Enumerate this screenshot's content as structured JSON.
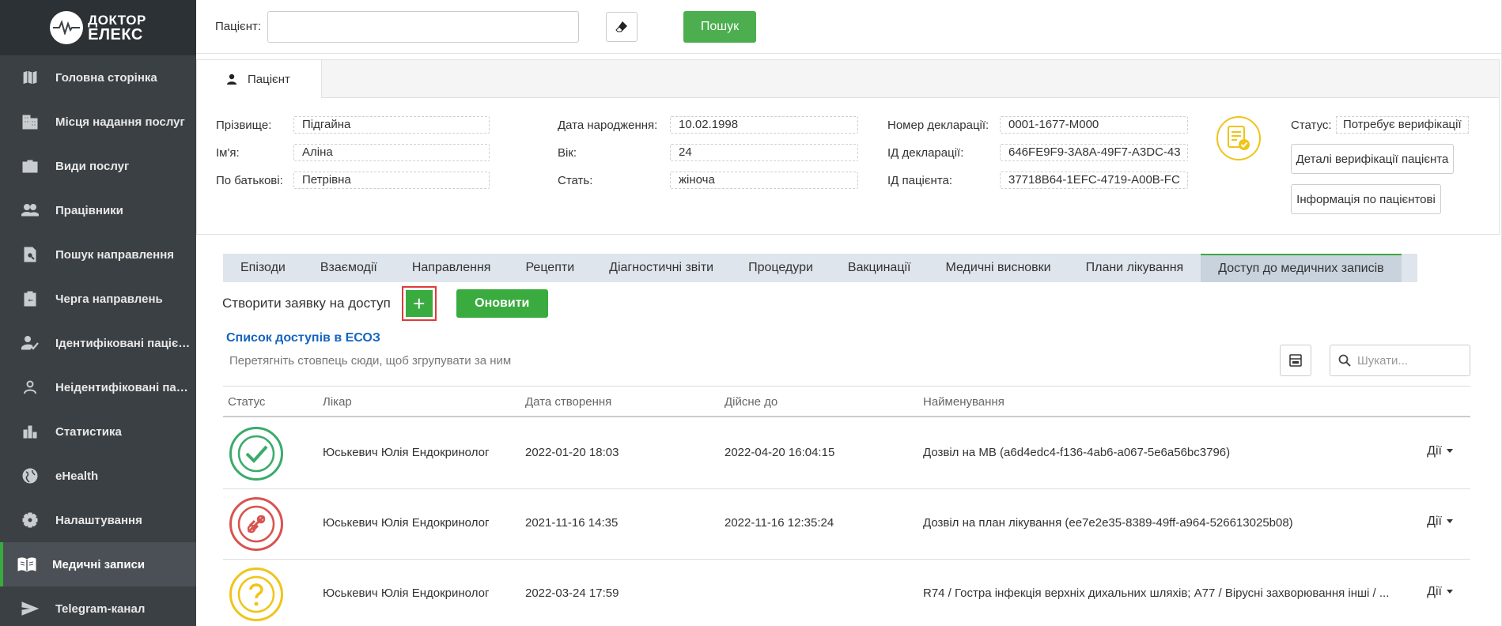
{
  "brand": {
    "line1": "ДОКТОР",
    "line2": "ЕЛЕКС"
  },
  "sidebar": {
    "items": [
      {
        "label": "Головна сторінка",
        "icon": "map-icon"
      },
      {
        "label": "Місця надання послуг",
        "icon": "building-icon"
      },
      {
        "label": "Види послуг",
        "icon": "briefcase-icon"
      },
      {
        "label": "Працівники",
        "icon": "people-icon"
      },
      {
        "label": "Пошук направлення",
        "icon": "doc-search-icon"
      },
      {
        "label": "Черга направлень",
        "icon": "clipboard-icon"
      },
      {
        "label": "Ідентифіковані пацієнти",
        "icon": "person-check-icon"
      },
      {
        "label": "Неідентифіковані пацієнти",
        "icon": "person-outline-icon"
      },
      {
        "label": "Статистика",
        "icon": "bar-chart-icon"
      },
      {
        "label": "eHealth",
        "icon": "globe-icon"
      },
      {
        "label": "Налаштування",
        "icon": "gear-icon"
      },
      {
        "label": "Медичні записи",
        "icon": "book-icon",
        "active": true
      },
      {
        "label": "Telegram-канал",
        "icon": "send-icon"
      }
    ]
  },
  "search": {
    "label": "Пацієнт:",
    "value": "",
    "button": "Пошук"
  },
  "patient_tab": "Пацієнт",
  "patient": {
    "surname_label": "Прізвище:",
    "surname": "Підгайна",
    "name_label": "Ім'я:",
    "name": "Аліна",
    "patronymic_label": "По батькові:",
    "patronymic": "Петрівна",
    "dob_label": "Дата народження:",
    "dob": "10.02.1998",
    "age_label": "Вік:",
    "age": "24",
    "sex_label": "Стать:",
    "sex": "жіноча",
    "decl_num_label": "Номер декларації:",
    "decl_num": "0001-1677-M000",
    "decl_id_label": "ІД декларації:",
    "decl_id": "646FE9F9-3A8A-49F7-A3DC-43",
    "patient_id_label": "ІД пацієнта:",
    "patient_id": "37718B64-1EFC-4719-A00B-FC",
    "status_label": "Статус:",
    "status": "Потребує верифікації",
    "verify_details_button": "Деталі верифікації пацієнта",
    "patient_info_button": "Інформація по пацієнтові"
  },
  "tabs": [
    "Епізоди",
    "Взаємодії",
    "Направлення",
    "Рецепти",
    "Діагностичні звіти",
    "Процедури",
    "Вакцинації",
    "Медичні висновки",
    "Плани лікування",
    "Доступ до медичних записів"
  ],
  "active_tab": "Доступ до медичних записів",
  "access": {
    "create_label": "Створити заявку на доступ",
    "plus": "+",
    "refresh_button": "Оновити",
    "list_title": "Список доступів в ЕСОЗ",
    "group_hint": "Перетягніть стовпець сюди, щоб згрупувати за ним",
    "search_placeholder": "Шукати..."
  },
  "grid": {
    "columns": [
      "Статус",
      "Лікар",
      "Дата створення",
      "Дійсне до",
      "Найменування"
    ],
    "actions_label": "Дії",
    "rows": [
      {
        "status": "approved",
        "status_color": "#3aab6a",
        "doctor": "Юськевич Юлія Ендокринолог",
        "created": "2022-01-20 18:03",
        "valid_until": "2022-04-20 16:04:15",
        "title": "Дозвіл на МВ (a6d4edc4-f136-4ab6-a067-5e6a56bc3796)"
      },
      {
        "status": "revoked",
        "status_color": "#d9534f",
        "doctor": "Юськевич Юлія Ендокринолог",
        "created": "2021-11-16 14:35",
        "valid_until": "2022-11-16 12:35:24",
        "title": "Дозвіл на план лікування (ee7e2e35-8389-49ff-a964-526613025b08)"
      },
      {
        "status": "pending",
        "status_color": "#f0c419",
        "doctor": "Юськевич Юлія Ендокринолог",
        "created": "2022-03-24 17:59",
        "valid_until": "",
        "title": "R74 / Гостра інфекція верхніх дихальних шляхів; A77 / Вірусні захворювання інші / ..."
      }
    ]
  }
}
